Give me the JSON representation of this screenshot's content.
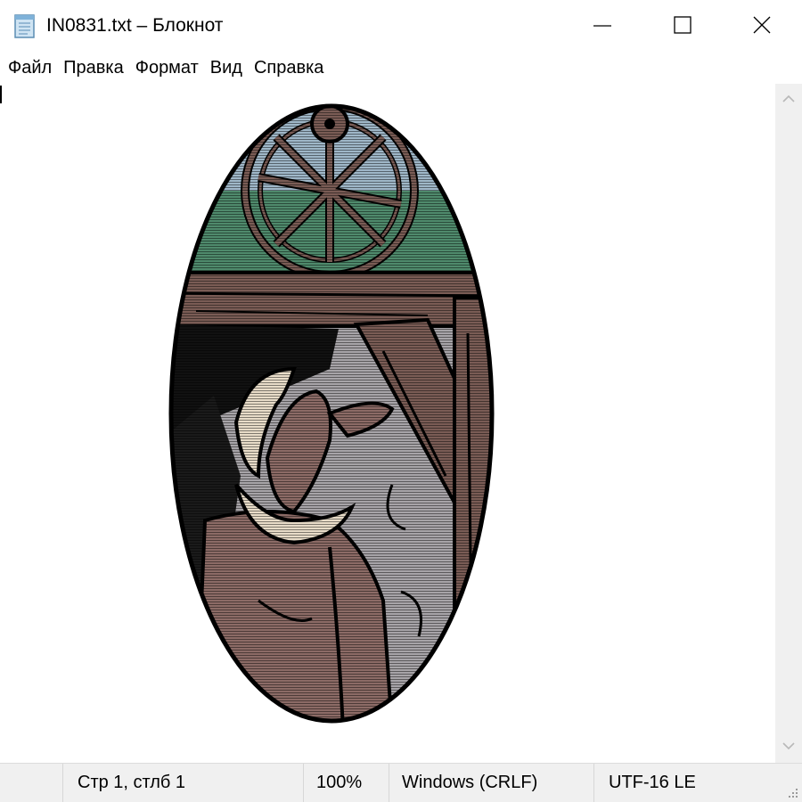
{
  "window": {
    "title": "IN0831.txt – Блокнот",
    "icon": "notepad-icon"
  },
  "controls": {
    "minimize_icon": "minimize-icon",
    "maximize_icon": "maximize-icon",
    "close_icon": "close-icon"
  },
  "menu": {
    "items": [
      {
        "label": "Файл"
      },
      {
        "label": "Правка"
      },
      {
        "label": "Формат"
      },
      {
        "label": "Вид"
      },
      {
        "label": "Справка"
      }
    ]
  },
  "editor": {
    "content": "oval ASCII-art image of a figure looking up at a wagon wheel on a wooden beam"
  },
  "status": {
    "position": "Стр 1, стлб 1",
    "zoom": "100%",
    "line_endings": "Windows (CRLF)",
    "encoding": "UTF-16 LE"
  },
  "colors": {
    "background": "#ffffff",
    "statusbar": "#f0f0f0",
    "wood": "#7a5c55",
    "sky": "#9fb7c8",
    "grass": "#4f8a6c",
    "stone": "#a7a4a8",
    "skin": "#8c6b66",
    "cloth": "#e8dcc8"
  }
}
